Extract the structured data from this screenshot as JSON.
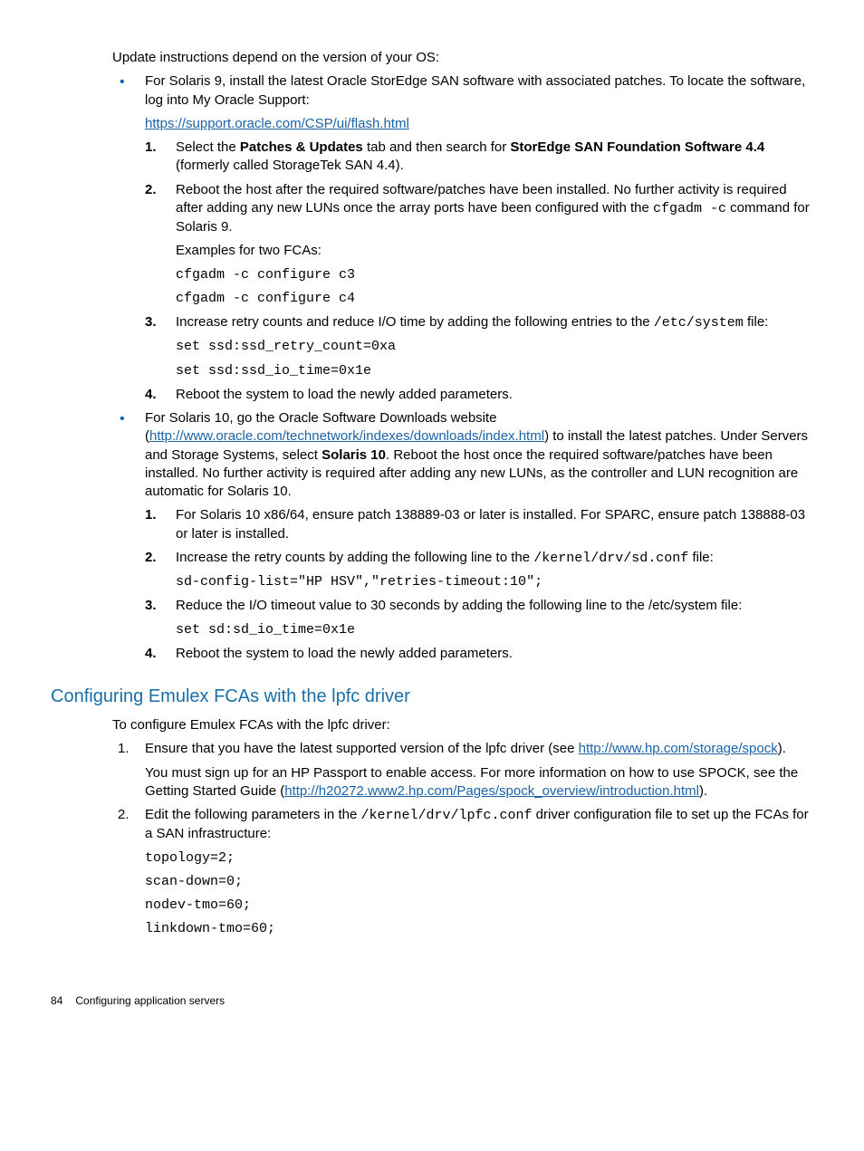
{
  "intro": "Update instructions depend on the version of your OS:",
  "b1": {
    "lead": "For Solaris 9, install the latest Oracle StorEdge SAN software with associated patches. To locate the software, log into My Oracle Support:",
    "link": "https://support.oracle.com/CSP/ui/flash.html",
    "s1_pre": "Select the ",
    "s1_bold1": "Patches & Updates",
    "s1_mid": " tab and then search for ",
    "s1_bold2": "StorEdge SAN Foundation Software 4.4",
    "s1_post": " (formerly called StorageTek SAN 4.4).",
    "s2_pre": "Reboot the host after the required software/patches have been installed. No further activity is required after adding any new LUNs once the array ports have been configured with the ",
    "s2_code": "cfgadm -c",
    "s2_post": " command for Solaris 9.",
    "s2_ex": "Examples for two FCAs:",
    "s2_cb1": "cfgadm -c configure c3",
    "s2_cb2": "cfgadm -c configure c4",
    "s3_pre": "Increase retry counts and reduce I/O time by adding the following entries to the ",
    "s3_code": "/etc/system",
    "s3_post": " file:",
    "s3_cb1": "set ssd:ssd_retry_count=0xa",
    "s3_cb2": "set ssd:ssd_io_time=0x1e",
    "s4": "Reboot the system to load the newly added parameters."
  },
  "b2": {
    "lead_pre": "For Solaris 10, go the Oracle Software Downloads website (",
    "lead_link": "http://www.oracle.com/technetwork/indexes/downloads/index.html",
    "lead_mid": ") to install the latest patches. Under Servers and Storage Systems, select ",
    "lead_bold": "Solaris 10",
    "lead_post": ". Reboot the host once the required software/patches have been installed. No further activity is required after adding any new LUNs, as the controller and LUN recognition are automatic for Solaris 10.",
    "s1": "For Solaris 10 x86/64, ensure patch 138889-03 or later is installed. For SPARC, ensure patch 138888-03 or later is installed.",
    "s2_pre": "Increase the retry counts by adding the following line to the ",
    "s2_code": "/kernel/drv/sd.conf",
    "s2_post": " file:",
    "s2_cb": "sd-config-list=\"HP HSV\",\"retries-timeout:10\";",
    "s3_pre": "Reduce the I/O timeout value to 30 seconds by adding the following line to the /etc/system file:",
    "s3_cb": "set sd:sd_io_time=0x1e",
    "s4": "Reboot the system to load the newly added parameters."
  },
  "section": {
    "title": "Configuring Emulex FCAs with the lpfc driver",
    "intro": "To configure Emulex FCAs with the lpfc driver:",
    "s1_pre": "Ensure that you have the latest supported version of the lpfc driver (see ",
    "s1_link": "http://www.hp.com/storage/spock",
    "s1_post": ").",
    "s1_p2_pre": "You must sign up for an HP Passport to enable access. For more information on how to use SPOCK, see the Getting Started Guide (",
    "s1_p2_link": "http://h20272.www2.hp.com/Pages/spock_overview/introduction.html",
    "s1_p2_post": ").",
    "s2_pre": "Edit the following parameters in the ",
    "s2_code": "/kernel/drv/lpfc.conf",
    "s2_post": " driver configuration file to set up the FCAs for a SAN infrastructure:",
    "s2_cb1": "topology=2;",
    "s2_cb2": "scan-down=0;",
    "s2_cb3": "nodev-tmo=60;",
    "s2_cb4": "linkdown-tmo=60;"
  },
  "footer": {
    "page": "84",
    "text": "Configuring application servers"
  },
  "nums": {
    "n1": "1.",
    "n2": "2.",
    "n3": "3.",
    "n4": "4."
  }
}
